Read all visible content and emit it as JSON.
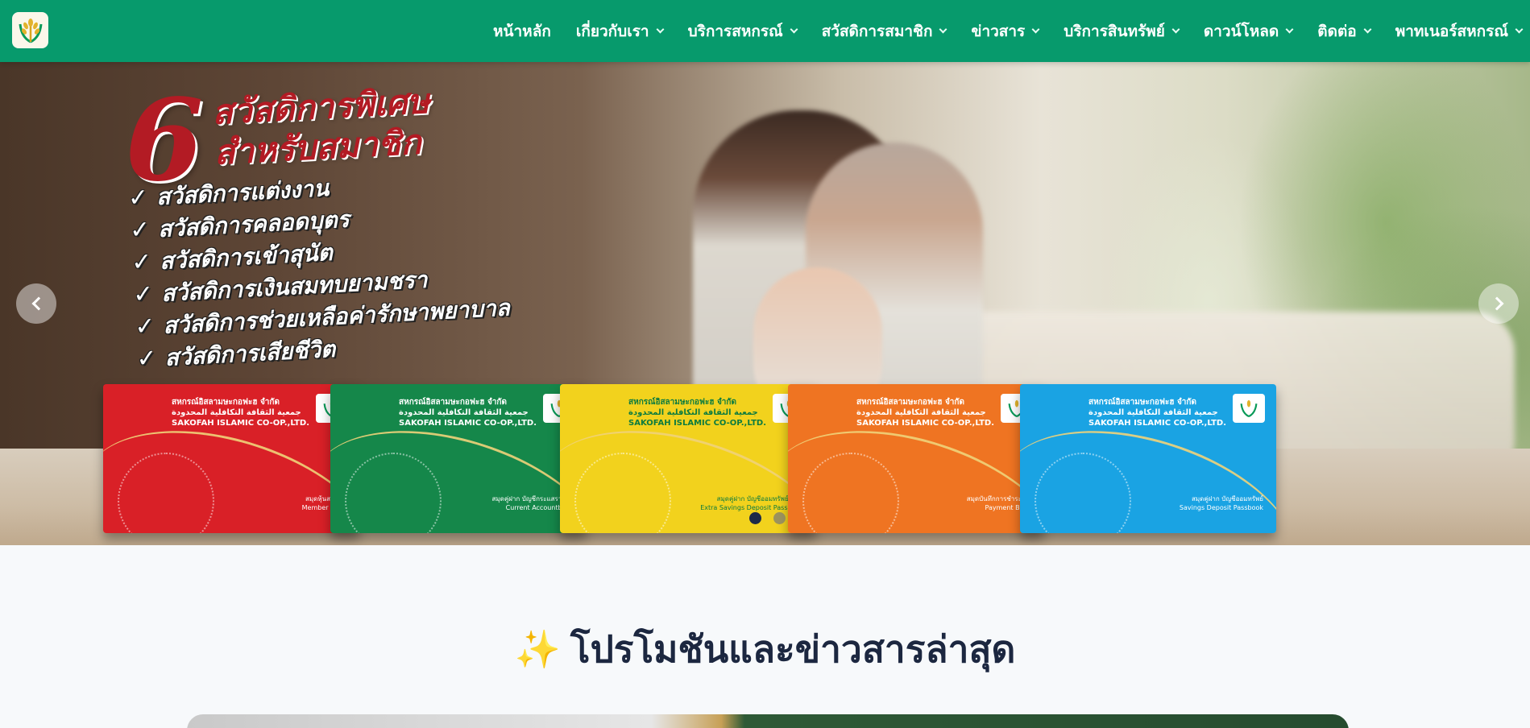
{
  "nav": {
    "items": [
      {
        "label": "หน้าหลัก",
        "dropdown": false
      },
      {
        "label": "เกี่ยวกับเรา",
        "dropdown": true
      },
      {
        "label": "บริการสหกรณ์",
        "dropdown": true
      },
      {
        "label": "สวัสดิการสมาชิก",
        "dropdown": true
      },
      {
        "label": "ข่าวสาร",
        "dropdown": true
      },
      {
        "label": "บริการสินทรัพย์",
        "dropdown": true
      },
      {
        "label": "ดาวน์โหลด",
        "dropdown": true
      },
      {
        "label": "ติดต่อ",
        "dropdown": true
      },
      {
        "label": "พาทเนอร์สหกรณ์",
        "dropdown": true
      }
    ],
    "logo_icon": "rice-sheaf-logo-icon"
  },
  "hero": {
    "number": "6",
    "title_line1": "สวัสดิการพิเศษ",
    "title_line2": "สำหรับสมาชิก",
    "benefits": [
      "สวัสดิการแต่งงาน",
      "สวัสดิการคลอดบุตร",
      "สวัสดิการเข้าสุนัต",
      "สวัสดิการเงินสมทบยามชรา",
      "สวัสดิการช่วยเหลือค่ารักษาพยาบาล",
      "สวัสดิการเสียชีวิต"
    ],
    "books": [
      {
        "color": "#d92027",
        "org_th": "สหกรณ์อิสลามษะกอฟะฮ จำกัด",
        "org_ar": "جمعية الثقافة التكافلية المحدودة",
        "org_en": "SAKOFAH ISLAMIC CO-OP.,LTD.",
        "type_th": "สมุดหุ้นสมาชิก",
        "type_en": "Member Book"
      },
      {
        "color": "#15874a",
        "org_th": "สหกรณ์อิสลามษะกอฟะฮ จำกัด",
        "org_ar": "جمعية الثقافة التكافلية المحدودة",
        "org_en": "SAKOFAH ISLAMIC CO-OP.,LTD.",
        "type_th": "สมุดคู่ฝาก บัญชีกระแสรายวัน",
        "type_en": "Current Accountbook"
      },
      {
        "color": "#f2d21d",
        "org_th": "สหกรณ์อิสลามษะกอฟะฮ จำกัด",
        "org_ar": "جمعية الثقافة التكافلية المحدودة",
        "org_en": "SAKOFAH ISLAMIC CO-OP.,LTD.",
        "type_th": "สมุดคู่ฝาก บัญชีออมทรัพย์พิเศษ",
        "type_en": "Extra Savings Deposit Passbook"
      },
      {
        "color": "#ef7422",
        "org_th": "สหกรณ์อิสลามษะกอฟะฮ จำกัด",
        "org_ar": "جمعية الثقافة التكافلية المحدودة",
        "org_en": "SAKOFAH ISLAMIC CO-OP.,LTD.",
        "type_th": "สมุดบันทึกการชำระเงิน",
        "type_en": "Payment Book"
      },
      {
        "color": "#1aa3e3",
        "org_th": "สหกรณ์อิสลามษะกอฟะฮ จำกัด",
        "org_ar": "جمعية الثقافة التكافلية المحدودة",
        "org_en": "SAKOFAH ISLAMIC CO-OP.,LTD.",
        "type_th": "สมุดคู่ฝาก บัญชีออมทรัพย์",
        "type_en": "Savings Deposit Passbook"
      }
    ],
    "slides": 2,
    "active_slide": 1
  },
  "section": {
    "icon": "sparkles-icon",
    "icon_glyph": "✨",
    "title": "โปรโมชันและข่าวสารล่าสุด"
  },
  "colors": {
    "navbar": "#079a6c",
    "accent_red": "#b31b24",
    "title": "#1c2740"
  }
}
